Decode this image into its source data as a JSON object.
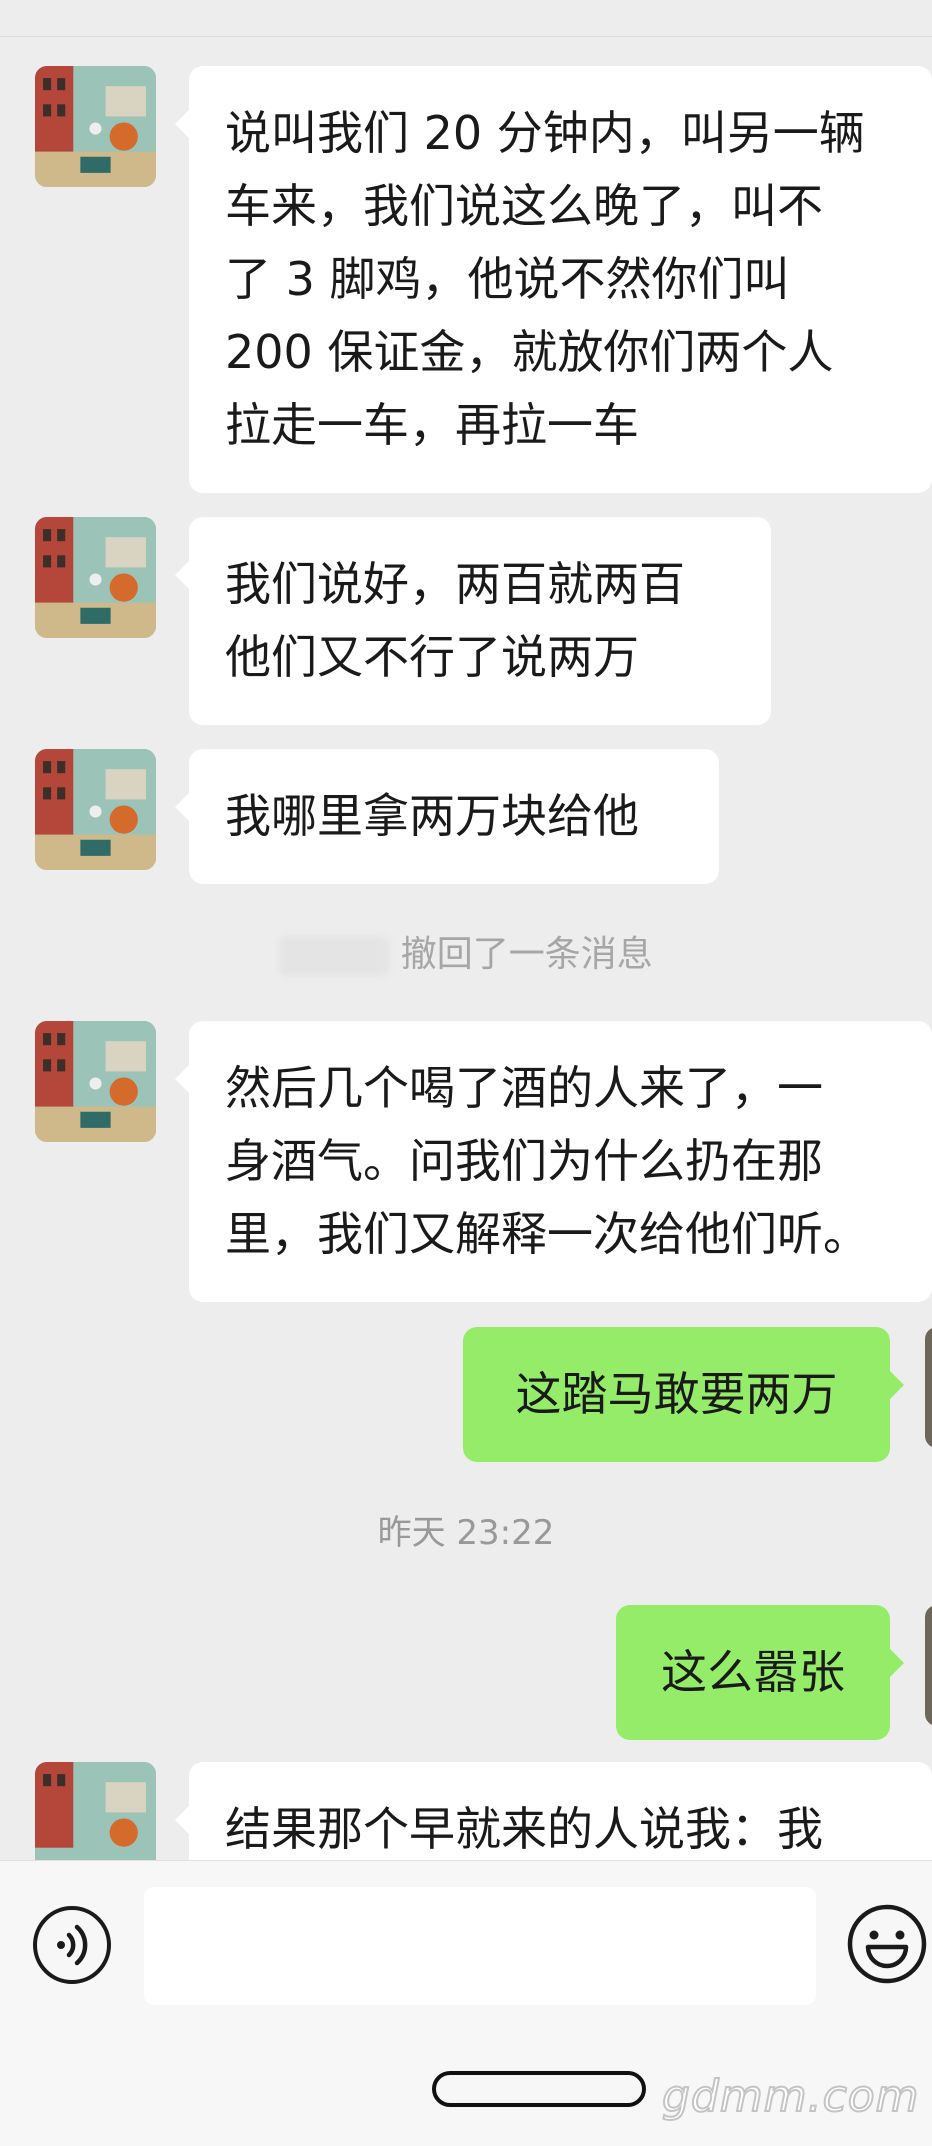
{
  "messages": [
    {
      "text": "说叫我们 20 分钟内，叫另一辆\n车来，我们说这么晚了，叫不\n了 3 脚鸡，他说不然你们叫\n200 保证金，就放你们两个人\n拉走一车，再拉一车"
    },
    {
      "text": "我们说好，两百就两百\n他们又不行了说两万"
    },
    {
      "text": "我哪里拿两万块给他"
    },
    {
      "recall": "撤回了一条消息"
    },
    {
      "text": "然后几个喝了酒的人来了，一\n身酒气。问我们为什么扔在那\n里，我们又解释一次给他们听。"
    },
    {
      "text": "这踏马敢要两万"
    },
    {
      "time": "昨天 23:22"
    },
    {
      "text": "这么嚣张"
    },
    {
      "text": "结果那个早就来的人说我：我"
    }
  ],
  "input": {
    "placeholder": ""
  },
  "watermark": "gdmm.com",
  "colors": {
    "incoming": "#ffffff",
    "outgoing": "#95ec69",
    "background": "#ededed"
  },
  "icons": {
    "voice": "voice-icon",
    "emoji": "emoji-icon"
  }
}
